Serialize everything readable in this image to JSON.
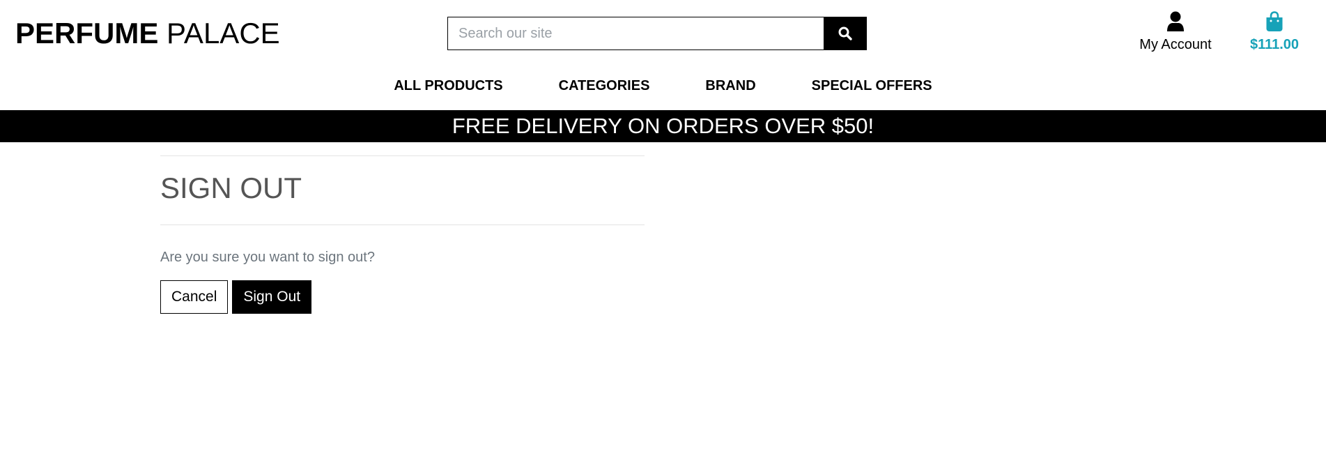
{
  "header": {
    "logo_bold": "PERFUME",
    "logo_light": "PALACE",
    "search": {
      "placeholder": "Search our site",
      "value": ""
    },
    "account_label": "My Account",
    "cart_amount": "$111.00",
    "colors": {
      "cart_accent": "#17a2b8"
    },
    "icons": {
      "search": "search-icon",
      "account": "user-icon",
      "cart": "shopping-bag-icon"
    }
  },
  "nav": {
    "items": [
      {
        "label": "ALL PRODUCTS"
      },
      {
        "label": "CATEGORIES"
      },
      {
        "label": "BRAND"
      },
      {
        "label": "SPECIAL OFFERS"
      }
    ]
  },
  "banner": {
    "text": "FREE DELIVERY ON ORDERS OVER $50!"
  },
  "main": {
    "title": "SIGN OUT",
    "question": "Are you sure you want to sign out?",
    "cancel_label": "Cancel",
    "signout_label": "Sign Out"
  }
}
